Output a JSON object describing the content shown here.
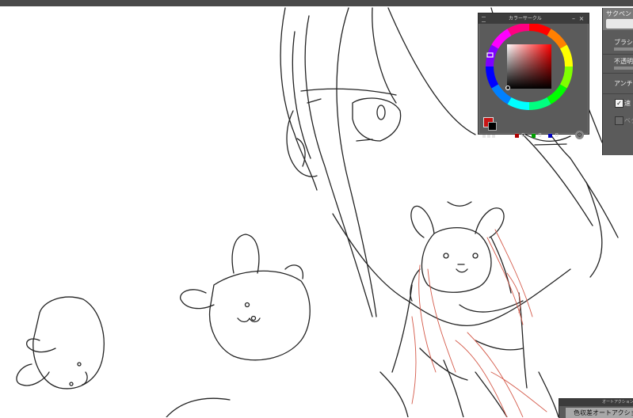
{
  "color_circle": {
    "title": "カラーサークル",
    "min_button": "–",
    "close_button": "×",
    "main_color": "#c81414",
    "sub_color": "#000000",
    "rgb": {
      "r": "0",
      "g": "0",
      "b": "0"
    },
    "chip_colors": {
      "r": "#b00000",
      "g": "#00a000",
      "b": "#0000c0"
    },
    "settings_icon": "gear-icon"
  },
  "tool_property": {
    "tool_name": "サクペン",
    "brush_size_label": "ブラシサ",
    "opacity_label": "不透明",
    "antialias_label": "アンチエイ",
    "stabilization_label": "速",
    "vector_label": "ベク",
    "stabilization_checked": true,
    "vector_checked": false
  },
  "auto_action": {
    "title": "オートアクション",
    "item_label": "色収差オートアクショ"
  }
}
